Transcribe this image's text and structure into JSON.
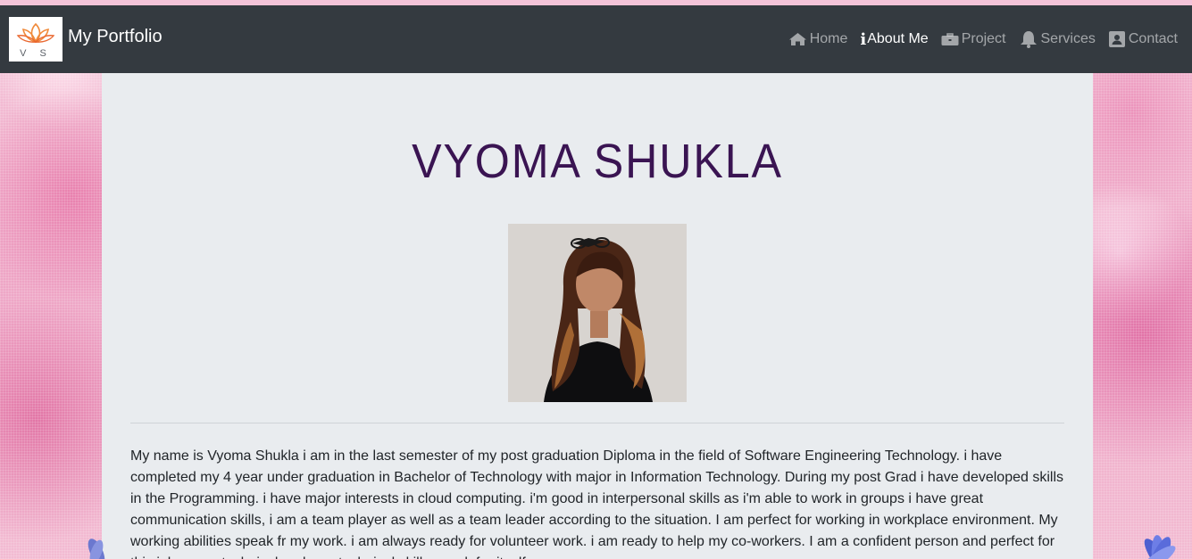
{
  "navbar": {
    "logo_monogram": "V S",
    "brand_name": "My Portfolio",
    "items": [
      {
        "label": "Home",
        "icon": "home-icon",
        "active": false
      },
      {
        "label": "About Me",
        "icon": "info-icon",
        "active": true
      },
      {
        "label": "Project",
        "icon": "briefcase-icon",
        "active": false
      },
      {
        "label": "Services",
        "icon": "bell-icon",
        "active": false
      },
      {
        "label": "Contact",
        "icon": "contact-card-icon",
        "active": false
      }
    ]
  },
  "main": {
    "title": "VYOMA SHUKLA",
    "photo_alt": "Vyoma Shukla",
    "bio": "My name is Vyoma Shukla i am in the last semester of my post graduation Diploma in the field of Software Engineering Technology. i have completed my 4 year under graduation in Bachelor of Technology with major in Information Technology. During my post Grad i have developed skills in the Programming. i have major interests in cloud computing. i'm good in interpersonal skills as i'm able to work in groups i have great communication skills, i am a team player as well as a team leader according to the situation. I am perfect for working in workplace environment. My working abilities speak fr my work. i am always ready for volunteer work. i am ready to help my co-workers. I am a confident person and perfect for this job as my technical and non-technical skills speak for itself."
  },
  "colors": {
    "navbar_bg": "#343a40",
    "title_color": "#3a1452",
    "content_bg": "#e9ecef",
    "background": "#efb2cd"
  }
}
